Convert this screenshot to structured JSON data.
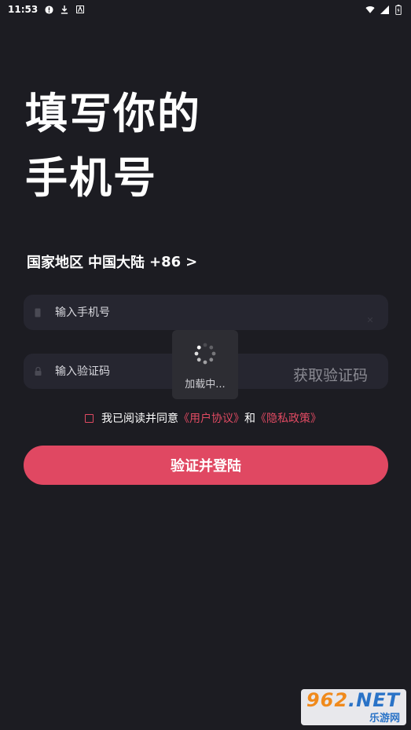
{
  "status_bar": {
    "time": "11:53",
    "icons_left": [
      "alert-icon",
      "download-icon",
      "app-icon"
    ],
    "icons_right": [
      "wifi-icon",
      "signal-icon",
      "battery-icon"
    ]
  },
  "header": {
    "title_line1": "填写你的",
    "title_line2": "手机号"
  },
  "region": {
    "label": "国家地区",
    "value": "中国大陆",
    "code": "+86",
    "arrow": ">"
  },
  "phone_field": {
    "placeholder": "输入手机号",
    "value": ""
  },
  "code_field": {
    "placeholder": "输入验证码",
    "value": "",
    "get_code_label": "获取验证码"
  },
  "agreement": {
    "prefix": "我已阅读并同意",
    "user_agreement": "《用户协议》",
    "and": "和",
    "privacy_policy": "《隐私政策》",
    "checked": false
  },
  "login_button": {
    "label": "验证并登陆"
  },
  "loading": {
    "text": "加载中..."
  },
  "watermark": {
    "logo_main": "962",
    "logo_net": ".NET",
    "sub": "乐游网"
  },
  "colors": {
    "background": "#1c1c22",
    "field_bg": "#262630",
    "accent": "#e04862",
    "muted_text": "#8a8a92"
  }
}
